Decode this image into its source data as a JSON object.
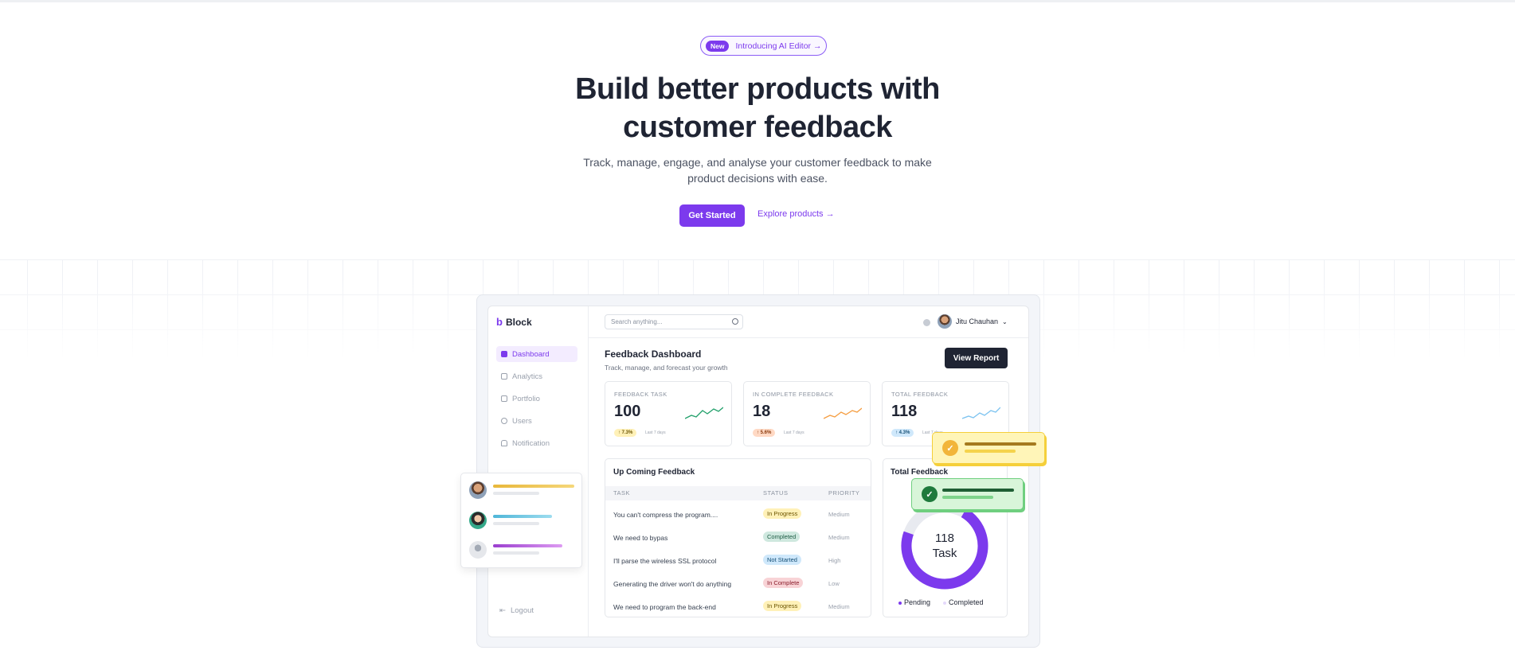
{
  "hero": {
    "badge_pill": "New",
    "badge_text": "Introducing AI Editor →",
    "title_line1": "Build better products with",
    "title_line2": "customer feedback",
    "subtitle": "Track, manage, engage, and analyse your customer feedback to make product decisions with ease.",
    "primary_button": "Get Started",
    "secondary_link": "Explore products →"
  },
  "sidebar": {
    "brand": "Block",
    "items": [
      {
        "label": "Dashboard",
        "icon": "grid-icon",
        "active": true
      },
      {
        "label": "Analytics",
        "icon": "chart-icon"
      },
      {
        "label": "Portfolio",
        "icon": "folder-icon"
      },
      {
        "label": "Users",
        "icon": "user-icon"
      },
      {
        "label": "Notification",
        "icon": "bell-icon"
      }
    ],
    "logout": "Logout"
  },
  "topbar": {
    "search_placeholder": "Search anything...",
    "user_name": "Jitu Chauhan"
  },
  "dashboard": {
    "title": "Feedback Dashboard",
    "subtitle": "Track, manage, and forecast your growth",
    "view_report": "View Report"
  },
  "stats": [
    {
      "label": "FEEDBACK TASK",
      "value": "100",
      "change": "↑ 7.3%",
      "period": "Last 7 days",
      "color": "#22a06b"
    },
    {
      "label": "IN COMPLETE FEEDBACK",
      "value": "18",
      "change": "↑ 5.6%",
      "period": "Last 7 days",
      "color": "#f59e42"
    },
    {
      "label": "TOTAL FEEDBACK",
      "value": "118",
      "change": "↑ 4.3%",
      "period": "Last 7 days",
      "color": "#7cc3f0"
    }
  ],
  "upcoming": {
    "title": "Up Coming Feedback",
    "columns": [
      "TASK",
      "STATUS",
      "PRIORITY"
    ],
    "rows": [
      {
        "task": "You can't compress the program....",
        "status": "In Progress",
        "priority": "Medium"
      },
      {
        "task": "We need to bypas",
        "status": "Completed",
        "priority": "Medium"
      },
      {
        "task": "I'll parse the wireless SSL protocol",
        "status": "Not Started",
        "priority": "High"
      },
      {
        "task": "Generating the driver won't do anything",
        "status": "In Complete",
        "priority": "Low"
      },
      {
        "task": "We need to program the back-end",
        "status": "In Progress",
        "priority": "Medium"
      }
    ]
  },
  "total_feedback": {
    "title": "Total Feedback",
    "center_value": "118",
    "center_label": "Task",
    "legend": [
      "Pending",
      "Completed"
    ],
    "pending_fraction": 0.72
  },
  "colors": {
    "accent": "#7c3aed",
    "dark": "#1f2433"
  }
}
